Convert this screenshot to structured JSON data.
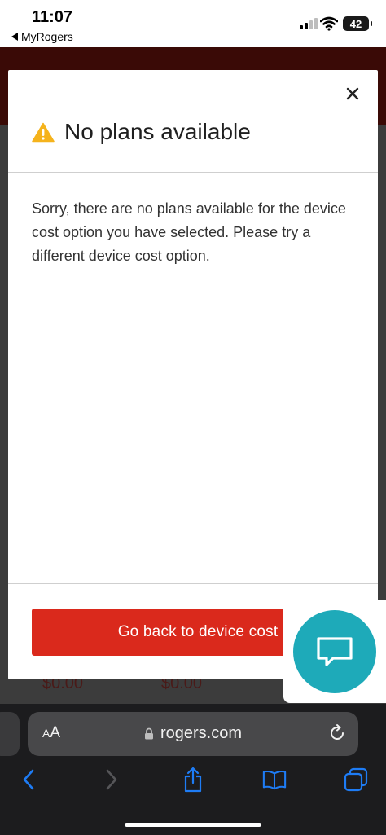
{
  "status_bar": {
    "time": "11:07",
    "back_app": "MyRogers",
    "battery": "42"
  },
  "background": {
    "price_left": "$0.00",
    "price_right": "$0.00"
  },
  "modal": {
    "title": "No plans available",
    "body": "Sorry, there are no plans available for the device cost option you have selected. Please try a different device cost option.",
    "primary_button": "Go back to device cost",
    "close_icon": "close-icon",
    "warning_icon": "warning-icon",
    "accent_color": "#da291c",
    "warning_color": "#f5b31c"
  },
  "chat": {
    "icon": "chat-bubble-icon",
    "color": "#1eaab9"
  },
  "safari": {
    "text_size_label_small": "A",
    "text_size_label_large": "A",
    "url": "rogers.com",
    "toolbar_icons": [
      "back-icon",
      "forward-icon",
      "share-icon",
      "bookmarks-icon",
      "tabs-icon"
    ]
  }
}
